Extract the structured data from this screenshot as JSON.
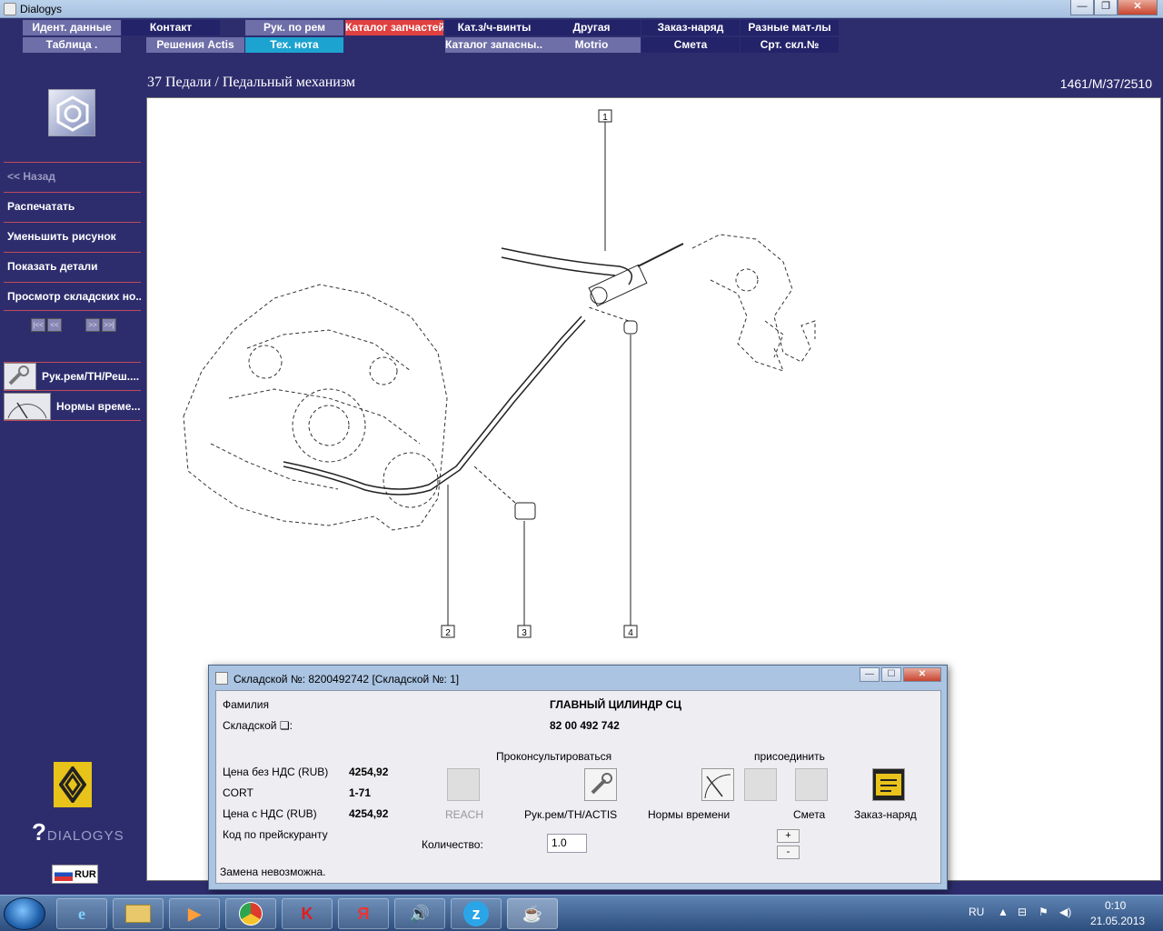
{
  "window": {
    "title": "Dialogys"
  },
  "menu_row1": [
    "Идент. данные",
    "Контакт",
    "Рук. по рем",
    "Каталог запчастей",
    "Кат.з/ч-винты",
    "Другая",
    "Заказ-наряд",
    "Разные мат-лы"
  ],
  "menu_row2": [
    "Таблица .",
    "Решения Actis",
    "Тех. нота",
    "",
    "Каталог запасны...",
    "Motrio",
    "Смета",
    "Срт. скл.№"
  ],
  "header": {
    "breadcrumb": "37 Педали / Педальный механизм",
    "code": "1461/M/37/2510"
  },
  "sidebar": {
    "back": "<< Назад",
    "print": "Распечатать",
    "shrink": "Уменьшить рисунок",
    "show_details": "Показать детали",
    "stock_view": "Просмотр складских но...",
    "tools": [
      "Рук.рем/TH/Реш....",
      "Нормы време..."
    ],
    "brand": "DIALOGYS",
    "currency": "RUR"
  },
  "diagram": {
    "callouts": [
      "1",
      "2",
      "3",
      "4"
    ]
  },
  "dialog": {
    "title": "Складской №: 8200492742 [Складской №: 1]",
    "family_label": "Фамилия",
    "family_value": "ГЛАВНЫЙ ЦИЛИНДР СЦ",
    "part_label": "Складской ❏:",
    "part_value": "82 00 492 742",
    "consult_label": "Проконсультироваться",
    "attach_label": "присоединить",
    "price_no_vat_label": "Цена без НДС (RUB)",
    "price_no_vat": "4254,92",
    "cort_label": "CORT",
    "cort_value": "1-71",
    "price_vat_label": "Цена с НДС (RUB)",
    "price_vat": "4254,92",
    "pricelist_label": "Код по прейскуранту",
    "reach_label": "REACH",
    "manual_label": "Рук.рем/TH/ACTIS",
    "time_norms_label": "Нормы времени",
    "estimate_label": "Смета",
    "order_label": "Заказ-наряд",
    "qty_label": "Количество:",
    "qty_value": "1.0",
    "plus": "+",
    "minus": "-",
    "status": "Замена невозможна."
  },
  "taskbar": {
    "lang": "RU",
    "time": "0:10",
    "date": "21.05.2013"
  }
}
